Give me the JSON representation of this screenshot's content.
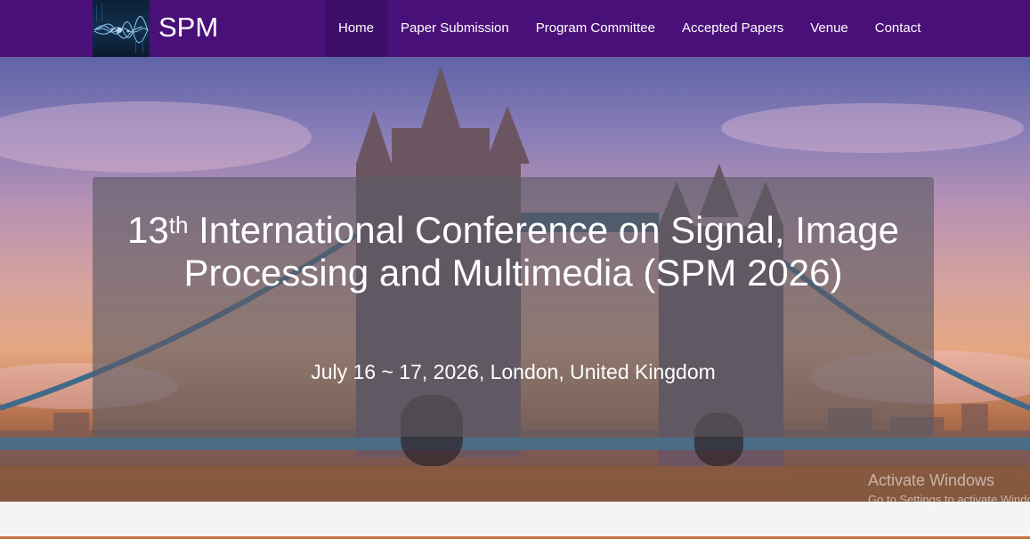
{
  "brand": {
    "name": "SPM",
    "logo_icon": "waveform-logo-icon"
  },
  "nav": {
    "items": [
      {
        "label": "Home"
      },
      {
        "label": "Paper Submission"
      },
      {
        "label": "Program Committee"
      },
      {
        "label": "Accepted Papers"
      },
      {
        "label": "Venue"
      },
      {
        "label": "Contact"
      }
    ]
  },
  "hero": {
    "title_ordinal": "13",
    "title_suffix": "th",
    "title_rest": " International Conference on Signal, Image Processing and Multimedia (SPM 2026)",
    "subtitle": "July 16 ~ 17, 2026, London, United Kingdom",
    "background_image": "tower-bridge-sunset-photo"
  },
  "watermark": {
    "line1": "Activate Windows",
    "line2": "Go to Settings to activate Windows."
  },
  "colors": {
    "navbar": "#4a1079",
    "nav_active": "#3f0d6a",
    "accent_line": "#c9733f"
  }
}
